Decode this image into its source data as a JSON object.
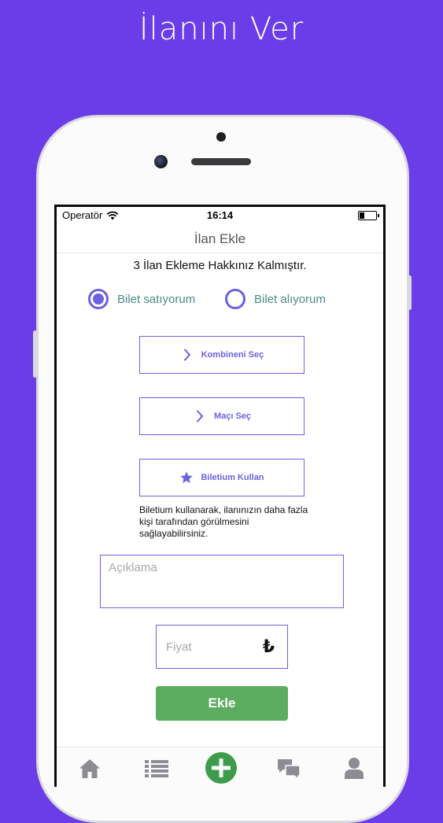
{
  "banner": {
    "title": "İlanını Ver"
  },
  "colors": {
    "background": "#6a3de8",
    "accent": "#6b62e0",
    "primary_green": "#5cad5f",
    "radio_label": "#4a8a8a"
  },
  "status_bar": {
    "carrier": "Operatör",
    "time": "16:14",
    "wifi_icon": "wifi-icon",
    "battery_level": 0.3
  },
  "nav": {
    "title": "İlan Ekle"
  },
  "quota_text": "3 İlan Ekleme Hakkınız Kalmıştır.",
  "ticket_mode": {
    "selected": "selling",
    "options": [
      {
        "id": "selling",
        "label": "Bilet satıyorum"
      },
      {
        "id": "buying",
        "label": "Bilet alıyorum"
      }
    ]
  },
  "actions": {
    "combined": {
      "label": "Kombineni Seç",
      "icon": "chevron-right-icon"
    },
    "match": {
      "label": "Maçı Seç",
      "icon": "chevron-right-icon"
    },
    "biletium": {
      "label": "Biletium Kullan",
      "icon": "star-icon"
    }
  },
  "biletium_hint": "Biletium kullanarak, ilanınızın daha fazla kişi tarafından görülmesini sağlayabilirsiniz.",
  "form": {
    "description_placeholder": "Açıklama",
    "price_placeholder": "Fiyat",
    "currency_symbol": "₺",
    "submit_label": "Ekle"
  },
  "tabbar": {
    "items": [
      {
        "id": "home",
        "icon": "home-icon"
      },
      {
        "id": "list",
        "icon": "list-icon"
      },
      {
        "id": "add",
        "icon": "add-icon",
        "active": true
      },
      {
        "id": "messages",
        "icon": "chat-bubbles-icon"
      },
      {
        "id": "profile",
        "icon": "user-icon"
      }
    ]
  }
}
